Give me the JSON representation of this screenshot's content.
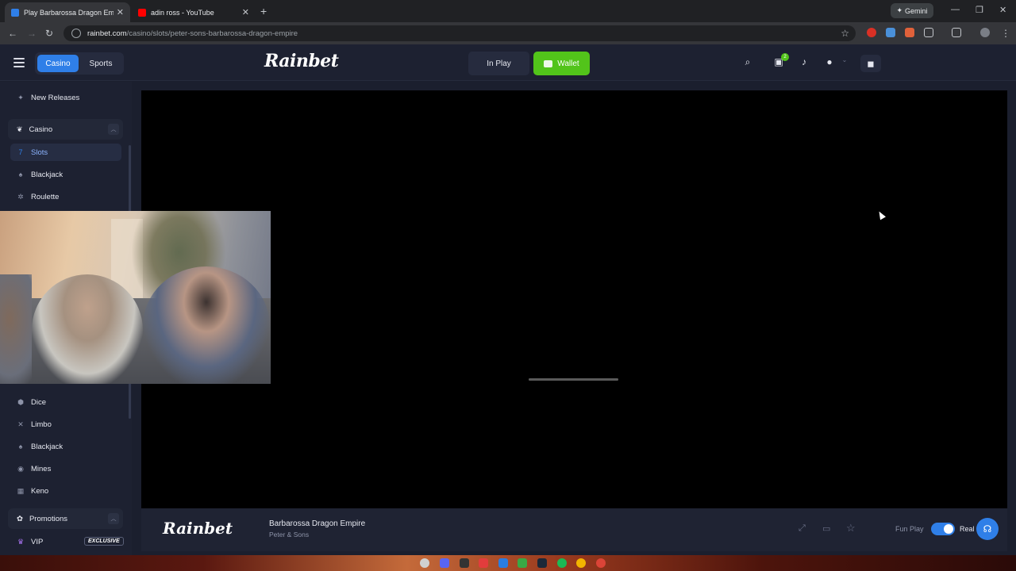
{
  "browser": {
    "tabs": [
      {
        "title": "Play Barbarossa Dragon Empire",
        "active": true,
        "favicon_color": "#2f7fe8"
      },
      {
        "title": "adin ross - YouTube",
        "active": false,
        "favicon_color": "#ff0000"
      }
    ],
    "gemini_label": "Gemini",
    "url_host": "rainbet.com",
    "url_path": "/casino/slots/peter-sons-barbarossa-dragon-empire"
  },
  "header": {
    "casino_label": "Casino",
    "sports_label": "Sports",
    "logo_text": "Rainbet",
    "in_play_label": "In Play",
    "wallet_label": "Wallet",
    "gift_badge": "2"
  },
  "sidebar": {
    "new_releases": "New Releases",
    "casino_group": "Casino",
    "casino_items": [
      {
        "label": "Slots",
        "icon": "slots-icon",
        "selected": true
      },
      {
        "label": "Blackjack",
        "icon": "blackjack-icon"
      },
      {
        "label": "Roulette",
        "icon": "roulette-icon"
      }
    ],
    "originals_items": [
      {
        "label": "Dice",
        "icon": "dice-icon"
      },
      {
        "label": "Limbo",
        "icon": "limbo-icon"
      },
      {
        "label": "Blackjack",
        "icon": "blackjack-icon"
      },
      {
        "label": "Mines",
        "icon": "mines-icon"
      },
      {
        "label": "Keno",
        "icon": "keno-icon"
      }
    ],
    "promotions_group": "Promotions",
    "vip_label": "VIP",
    "vip_tag": "EXCLUSIVE"
  },
  "game": {
    "logo_text": "Rainbet",
    "title": "Barbarossa Dragon Empire",
    "provider": "Peter & Sons",
    "fun_play_label": "Fun Play",
    "real_label": "Real",
    "real_play_enabled": true
  },
  "colors": {
    "accent": "#2f7fe8",
    "wallet_green": "#52c41a",
    "page_bg": "#1b1f2e"
  }
}
